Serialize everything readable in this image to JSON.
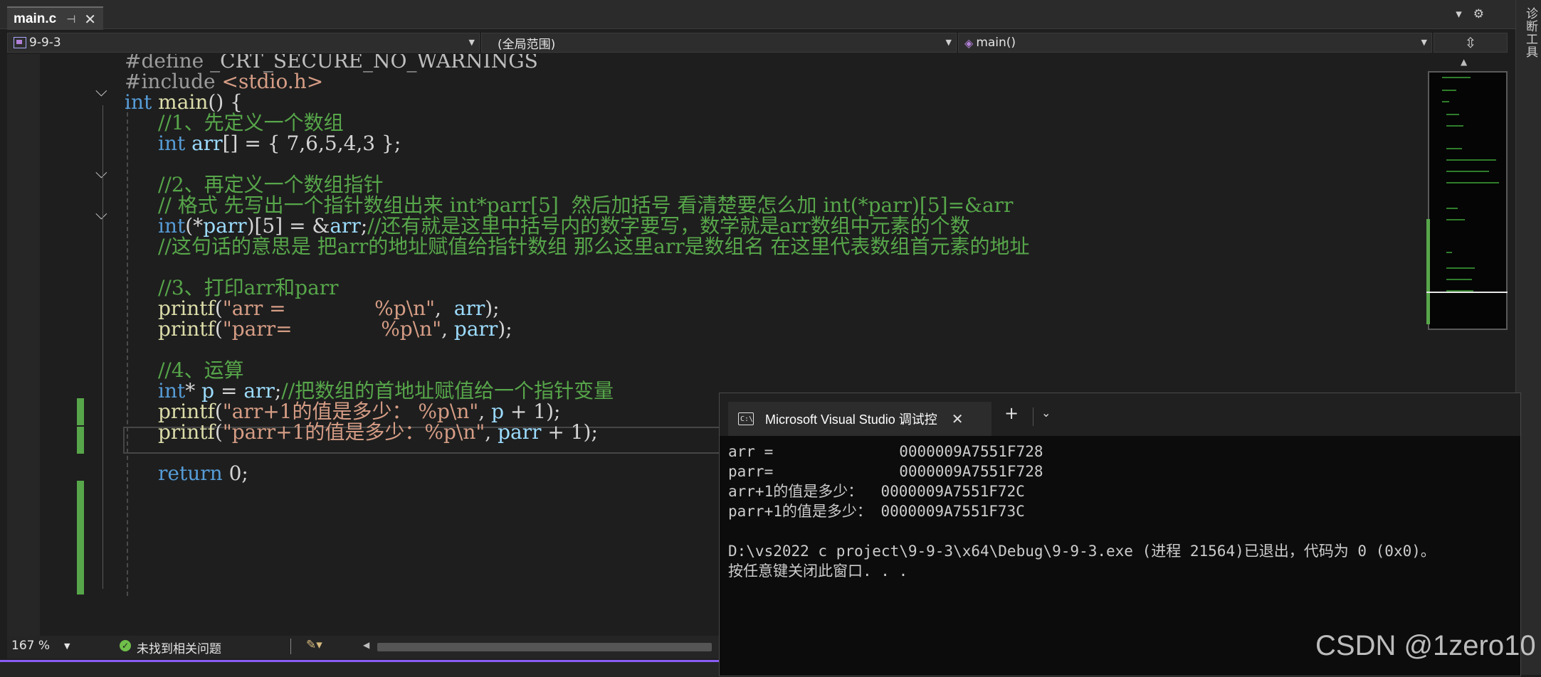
{
  "tab": {
    "title": "main.c",
    "pin_icon": "pin-icon",
    "close_icon": "close-icon"
  },
  "navbar": {
    "project": "9-9-3",
    "scope": "(全局范围)",
    "function": "main()"
  },
  "side_panel": {
    "label": "诊断工具"
  },
  "code": {
    "l1": {
      "pp": "#define",
      "mac": "_CRT_SECURE_NO_WARNINGS"
    },
    "l2": {
      "pp": "#include",
      "inc": "<stdio.h>"
    },
    "l3": {
      "kw": "int",
      "fn": "main",
      "rest": "() {"
    },
    "l4": {
      "cm": "//1、先定义一个数组"
    },
    "l5": {
      "kw": "int",
      "id": "arr",
      "rest": "[] = { 7,6,5,4,3 };"
    },
    "l7": {
      "cm": "//2、再定义一个数组指针"
    },
    "l8": {
      "cm": "// 格式 先写出一个指针数组出来 int*parr[5]  然后加括号 看清楚要怎么加 int(*parr)[5]=&arr"
    },
    "l9": {
      "kw": "int",
      "p1": "(*",
      "id1": "parr",
      "p2": ")[5] = &",
      "id2": "arr",
      "p3": ";",
      "cm": "//还有就是这里中括号内的数字要写，数学就是arr数组中元素的个数"
    },
    "l10": {
      "cm": "//这句话的意思是 把arr的地址赋值给指针数组 那么这里arr是数组名 在这里代表数组首元素的地址"
    },
    "l12": {
      "cm": "//3、打印arr和parr"
    },
    "l13": {
      "fn": "printf",
      "p1": "(",
      "st": "\"arr =              %p\\n\"",
      "p2": ",  ",
      "id": "arr",
      "p3": ");"
    },
    "l14": {
      "fn": "printf",
      "p1": "(",
      "st": "\"parr=              %p\\n\"",
      "p2": ", ",
      "id": "parr",
      "p3": ");"
    },
    "l16": {
      "cm": "//4、运算"
    },
    "l17": {
      "kw": "int",
      "p1": "* ",
      "id1": "p",
      "p2": " = ",
      "id2": "arr",
      "p3": ";",
      "cm": "//把数组的首地址赋值给一个指针变量"
    },
    "l18": {
      "fn": "printf",
      "p1": "(",
      "st": "\"arr+1的值是多少： %p\\n\"",
      "p2": ", ",
      "id": "p",
      "p3": " + 1);"
    },
    "l19": {
      "fn": "printf",
      "p1": "(",
      "st": "\"parr+1的值是多少：%p\\n\"",
      "p2": ", ",
      "id": "parr",
      "p3": " + 1);"
    },
    "l21": {
      "kw": "return",
      "rest": " 0;"
    }
  },
  "status": {
    "zoom": "167 %",
    "issues": "未找到相关问题"
  },
  "console": {
    "tab_title": "Microsoft Visual Studio 调试控",
    "new_tab": "+",
    "lines": [
      "arr =              0000009A7551F728",
      "parr=              0000009A7551F728",
      "arr+1的值是多少：  0000009A7551F72C",
      "parr+1的值是多少： 0000009A7551F73C",
      "",
      "D:\\vs2022 c project\\9-9-3\\x64\\Debug\\9-9-3.exe (进程 21564)已退出，代码为 0 (0x0)。",
      "按任意键关闭此窗口. . ."
    ]
  },
  "watermark": "CSDN @1zero10",
  "colors": {
    "keyword": "#569cd6",
    "comment": "#57a64a",
    "string": "#d69d85",
    "function": "#dcdcaa",
    "identifier": "#9cdcfe",
    "accent": "#8a5cf5"
  }
}
